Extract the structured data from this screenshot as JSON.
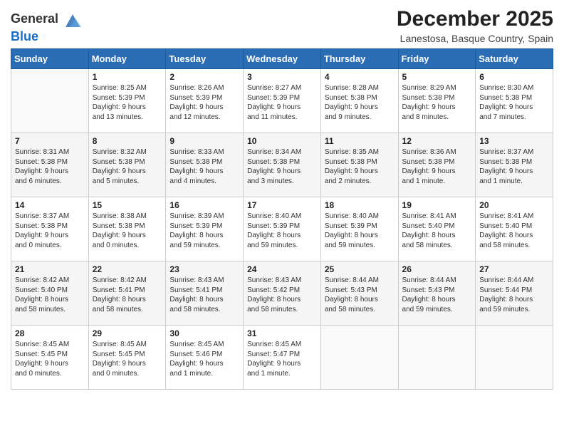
{
  "header": {
    "logo_general": "General",
    "logo_blue": "Blue",
    "title": "December 2025",
    "subtitle": "Lanestosa, Basque Country, Spain"
  },
  "days_of_week": [
    "Sunday",
    "Monday",
    "Tuesday",
    "Wednesday",
    "Thursday",
    "Friday",
    "Saturday"
  ],
  "weeks": [
    [
      {
        "day": "",
        "content": ""
      },
      {
        "day": "1",
        "content": "Sunrise: 8:25 AM\nSunset: 5:39 PM\nDaylight: 9 hours\nand 13 minutes."
      },
      {
        "day": "2",
        "content": "Sunrise: 8:26 AM\nSunset: 5:39 PM\nDaylight: 9 hours\nand 12 minutes."
      },
      {
        "day": "3",
        "content": "Sunrise: 8:27 AM\nSunset: 5:39 PM\nDaylight: 9 hours\nand 11 minutes."
      },
      {
        "day": "4",
        "content": "Sunrise: 8:28 AM\nSunset: 5:38 PM\nDaylight: 9 hours\nand 9 minutes."
      },
      {
        "day": "5",
        "content": "Sunrise: 8:29 AM\nSunset: 5:38 PM\nDaylight: 9 hours\nand 8 minutes."
      },
      {
        "day": "6",
        "content": "Sunrise: 8:30 AM\nSunset: 5:38 PM\nDaylight: 9 hours\nand 7 minutes."
      }
    ],
    [
      {
        "day": "7",
        "content": "Sunrise: 8:31 AM\nSunset: 5:38 PM\nDaylight: 9 hours\nand 6 minutes."
      },
      {
        "day": "8",
        "content": "Sunrise: 8:32 AM\nSunset: 5:38 PM\nDaylight: 9 hours\nand 5 minutes."
      },
      {
        "day": "9",
        "content": "Sunrise: 8:33 AM\nSunset: 5:38 PM\nDaylight: 9 hours\nand 4 minutes."
      },
      {
        "day": "10",
        "content": "Sunrise: 8:34 AM\nSunset: 5:38 PM\nDaylight: 9 hours\nand 3 minutes."
      },
      {
        "day": "11",
        "content": "Sunrise: 8:35 AM\nSunset: 5:38 PM\nDaylight: 9 hours\nand 2 minutes."
      },
      {
        "day": "12",
        "content": "Sunrise: 8:36 AM\nSunset: 5:38 PM\nDaylight: 9 hours\nand 1 minute."
      },
      {
        "day": "13",
        "content": "Sunrise: 8:37 AM\nSunset: 5:38 PM\nDaylight: 9 hours\nand 1 minute."
      }
    ],
    [
      {
        "day": "14",
        "content": "Sunrise: 8:37 AM\nSunset: 5:38 PM\nDaylight: 9 hours\nand 0 minutes."
      },
      {
        "day": "15",
        "content": "Sunrise: 8:38 AM\nSunset: 5:38 PM\nDaylight: 9 hours\nand 0 minutes."
      },
      {
        "day": "16",
        "content": "Sunrise: 8:39 AM\nSunset: 5:39 PM\nDaylight: 8 hours\nand 59 minutes."
      },
      {
        "day": "17",
        "content": "Sunrise: 8:40 AM\nSunset: 5:39 PM\nDaylight: 8 hours\nand 59 minutes."
      },
      {
        "day": "18",
        "content": "Sunrise: 8:40 AM\nSunset: 5:39 PM\nDaylight: 8 hours\nand 59 minutes."
      },
      {
        "day": "19",
        "content": "Sunrise: 8:41 AM\nSunset: 5:40 PM\nDaylight: 8 hours\nand 58 minutes."
      },
      {
        "day": "20",
        "content": "Sunrise: 8:41 AM\nSunset: 5:40 PM\nDaylight: 8 hours\nand 58 minutes."
      }
    ],
    [
      {
        "day": "21",
        "content": "Sunrise: 8:42 AM\nSunset: 5:40 PM\nDaylight: 8 hours\nand 58 minutes."
      },
      {
        "day": "22",
        "content": "Sunrise: 8:42 AM\nSunset: 5:41 PM\nDaylight: 8 hours\nand 58 minutes."
      },
      {
        "day": "23",
        "content": "Sunrise: 8:43 AM\nSunset: 5:41 PM\nDaylight: 8 hours\nand 58 minutes."
      },
      {
        "day": "24",
        "content": "Sunrise: 8:43 AM\nSunset: 5:42 PM\nDaylight: 8 hours\nand 58 minutes."
      },
      {
        "day": "25",
        "content": "Sunrise: 8:44 AM\nSunset: 5:43 PM\nDaylight: 8 hours\nand 58 minutes."
      },
      {
        "day": "26",
        "content": "Sunrise: 8:44 AM\nSunset: 5:43 PM\nDaylight: 8 hours\nand 59 minutes."
      },
      {
        "day": "27",
        "content": "Sunrise: 8:44 AM\nSunset: 5:44 PM\nDaylight: 8 hours\nand 59 minutes."
      }
    ],
    [
      {
        "day": "28",
        "content": "Sunrise: 8:45 AM\nSunset: 5:45 PM\nDaylight: 9 hours\nand 0 minutes."
      },
      {
        "day": "29",
        "content": "Sunrise: 8:45 AM\nSunset: 5:45 PM\nDaylight: 9 hours\nand 0 minutes."
      },
      {
        "day": "30",
        "content": "Sunrise: 8:45 AM\nSunset: 5:46 PM\nDaylight: 9 hours\nand 1 minute."
      },
      {
        "day": "31",
        "content": "Sunrise: 8:45 AM\nSunset: 5:47 PM\nDaylight: 9 hours\nand 1 minute."
      },
      {
        "day": "",
        "content": ""
      },
      {
        "day": "",
        "content": ""
      },
      {
        "day": "",
        "content": ""
      }
    ]
  ]
}
